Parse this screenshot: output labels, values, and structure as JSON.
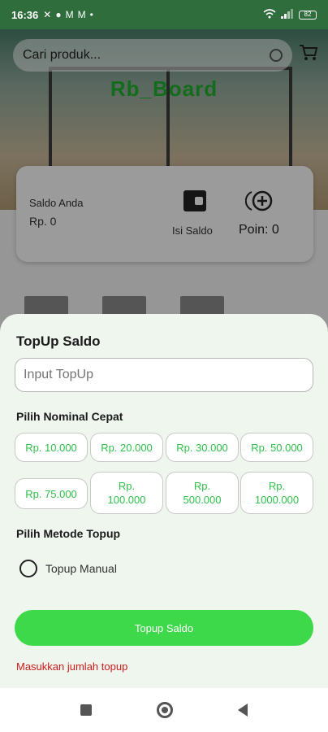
{
  "status_bar": {
    "time": "16:36",
    "battery": "82"
  },
  "search": {
    "placeholder": "Cari produk..."
  },
  "brand": {
    "name": "Rb_Board"
  },
  "saldo_card": {
    "label": "Saldo Anda",
    "value": "Rp. 0",
    "isi_label": "Isi Saldo",
    "poin_label": "Poin: 0"
  },
  "sheet": {
    "title": "TopUp Saldo",
    "input_placeholder": "Input TopUp",
    "quick_label": "Pilih Nominal Cepat",
    "nominals": [
      "Rp. 10.000",
      "Rp. 20.000",
      "Rp. 30.000",
      "Rp. 50.000",
      "Rp. 75.000",
      "Rp.\n100.000",
      "Rp.\n500.000",
      "Rp.\n1000.000"
    ],
    "method_label": "Pilih Metode Topup",
    "method_option": "Topup Manual",
    "submit_label": "Topup Saldo",
    "error_text": "Masukkan jumlah topup"
  },
  "colors": {
    "accent": "#3dd94a",
    "chip_text": "#2ec24a",
    "error": "#d21a1a",
    "status_bar": "#2f6e3c"
  },
  "icons": [
    "wifi-icon",
    "signal-icon",
    "battery-icon",
    "cart-icon",
    "wallet-icon",
    "add-circle-icon",
    "nav-recent-icon",
    "nav-home-icon",
    "nav-back-icon"
  ]
}
